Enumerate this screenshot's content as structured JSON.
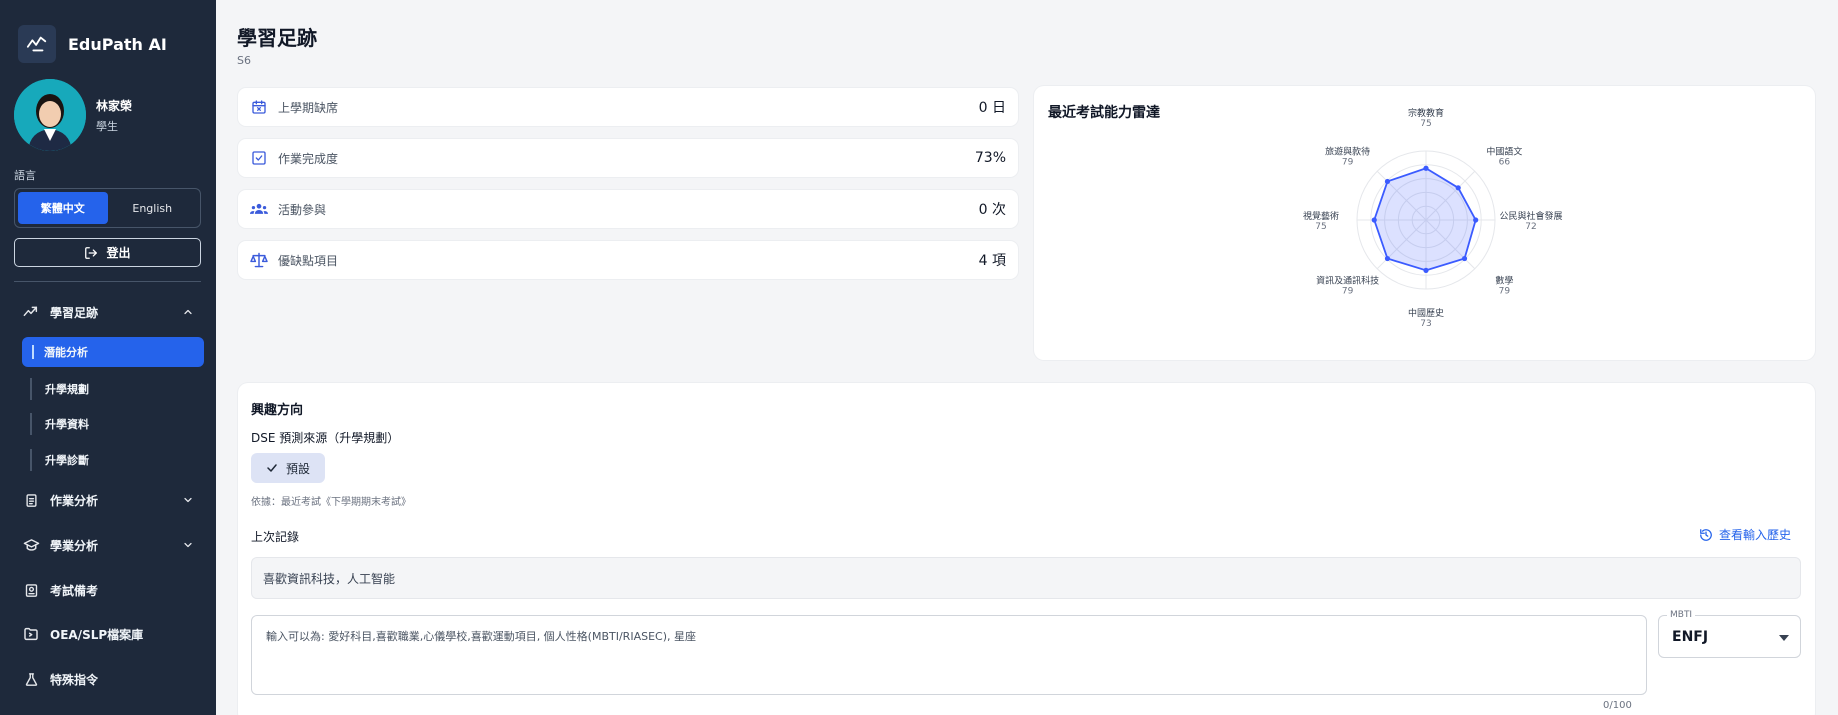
{
  "sidebar": {
    "brand": "EduPath AI",
    "user_name": "林家榮",
    "user_role": "學生",
    "lang_label": "語言",
    "lang_options": [
      "繁體中文",
      "English"
    ],
    "logout": "登出",
    "nav": [
      {
        "label": "學習足跡",
        "icon": "trending-icon",
        "expanded": true
      },
      {
        "label": "作業分析",
        "icon": "document-icon"
      },
      {
        "label": "學業分析",
        "icon": "graduation-cap-icon"
      },
      {
        "label": "考試備考",
        "icon": "exam-book-icon"
      },
      {
        "label": "OEA/SLP檔案庫",
        "icon": "folder-icon"
      },
      {
        "label": "特殊指令",
        "icon": "flask-icon"
      }
    ],
    "subnav": [
      "潛能分析",
      "升學規劃",
      "升學資料",
      "升學診斷"
    ]
  },
  "main": {
    "title": "學習足跡",
    "subtitle": "S6",
    "stats": [
      {
        "label": "上學期缺席",
        "value": "0 日",
        "icon": "calendar-x-icon"
      },
      {
        "label": "作業完成度",
        "value": "73%",
        "icon": "check-square-icon"
      },
      {
        "label": "活動參與",
        "value": "0 次",
        "icon": "group-icon"
      },
      {
        "label": "優缺點項目",
        "value": "4 項",
        "icon": "scale-icon"
      }
    ]
  },
  "radar": {
    "title": "最近考試能力雷達"
  },
  "chart_data": {
    "type": "radar",
    "title": "最近考試能力雷達",
    "categories": [
      "宗教教育",
      "中國語文",
      "公民與社會發展",
      "數學",
      "中國歷史",
      "資訊及通訊科技",
      "視覺藝術",
      "旅遊與款待"
    ],
    "values": [
      75,
      66,
      72,
      79,
      73,
      79,
      75,
      79
    ],
    "range": [
      0,
      100
    ],
    "color": "#3b5bff"
  },
  "interest": {
    "title": "興趣方向",
    "dse_label": "DSE 預測來源（升學規劃）",
    "chip": "預設",
    "basis": "依據：最近考試《下學期期末考試》",
    "last_label": "上次記錄",
    "history_link": "查看輸入歷史",
    "last_value": "喜歡資訊科技，人工智能",
    "input_placeholder": "輸入可以為: 愛好科目,喜歡職業,心儀學校,喜歡運動項目, 個人性格(MBTI/RIASEC), 星座",
    "char_count": "0/100",
    "mbti_label": "MBTI",
    "mbti_value": "ENFJ"
  }
}
